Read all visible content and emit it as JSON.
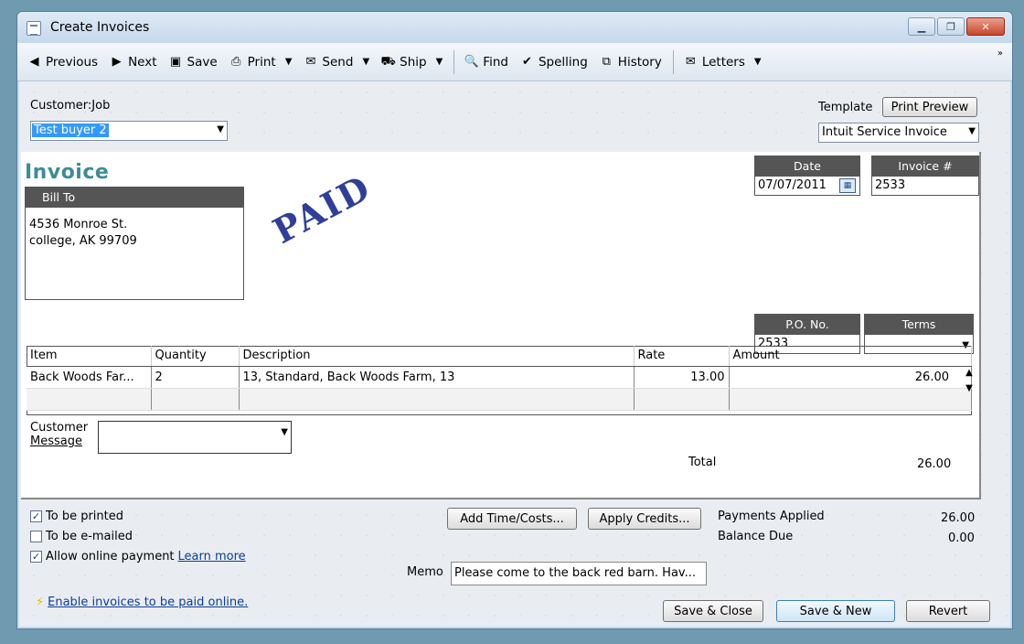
{
  "window": {
    "title": "Create Invoices"
  },
  "toolbar": {
    "previous": "Previous",
    "next": "Next",
    "save": "Save",
    "print": "Print",
    "send": "Send",
    "ship": "Ship",
    "find": "Find",
    "spelling": "Spelling",
    "history": "History",
    "letters": "Letters"
  },
  "customer_job": {
    "label": "Customer:Job",
    "value": "Test buyer 2"
  },
  "template": {
    "label": "Template",
    "print_preview": "Print Preview",
    "value": "Intuit Service Invoice"
  },
  "invoice": {
    "title": "Invoice",
    "stamp": "PAID",
    "bill_to": {
      "header": "Bill To",
      "line1": "4536 Monroe St.",
      "line2": "college, AK 99709"
    },
    "date": {
      "header": "Date",
      "value": "07/07/2011"
    },
    "number": {
      "header": "Invoice #",
      "value": "2533"
    },
    "po": {
      "header": "P.O. No.",
      "value": "2533"
    },
    "terms": {
      "header": "Terms",
      "value": ""
    }
  },
  "items": {
    "columns": [
      "Item",
      "Quantity",
      "Description",
      "Rate",
      "Amount"
    ],
    "rows": [
      {
        "item": "Back Woods Far...",
        "quantity": "2",
        "description": "13, Standard, Back Woods Farm, 13",
        "rate": "13.00",
        "amount": "26.00"
      }
    ]
  },
  "customer_message": {
    "label_line1": "Customer",
    "label_line2": "Message",
    "value": ""
  },
  "total": {
    "label": "Total",
    "value": "26.00"
  },
  "options": {
    "to_be_printed": {
      "label": "To be printed",
      "checked": true
    },
    "to_be_emailed": {
      "label": "To be e-mailed",
      "checked": false
    },
    "online_payment": {
      "label": "Allow online payment",
      "checked": true,
      "link": "Learn more"
    }
  },
  "buttons": {
    "add_time_costs": "Add Time/Costs...",
    "apply_credits": "Apply Credits...",
    "save_close": "Save & Close",
    "save_new": "Save & New",
    "revert": "Revert"
  },
  "payments": {
    "applied_label": "Payments Applied",
    "applied_value": "26.00",
    "balance_label": "Balance Due",
    "balance_value": "0.00"
  },
  "memo": {
    "label": "Memo",
    "value": "Please come to the back red barn. Hav..."
  },
  "enable_online": "Enable invoices to be paid online."
}
